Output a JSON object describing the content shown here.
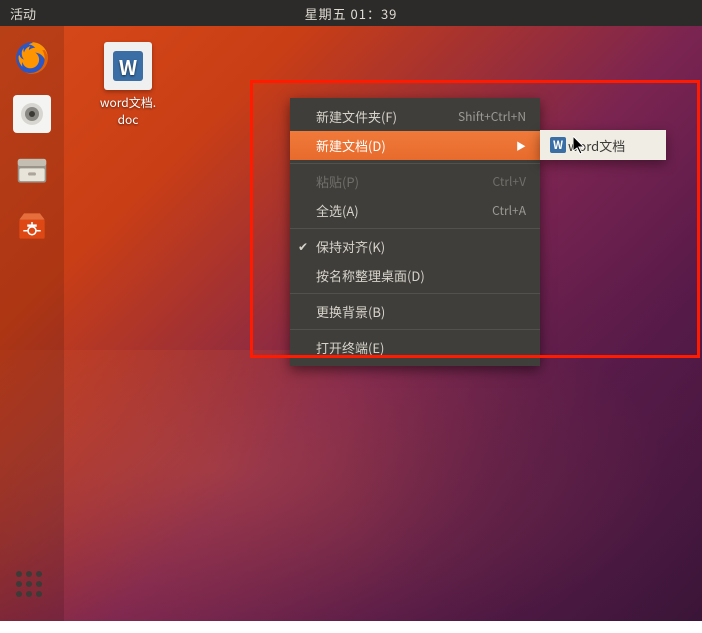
{
  "topbar": {
    "activities": "活动",
    "clock": "星期五 01：39"
  },
  "desktop_icon": {
    "letter": "W",
    "label": "word文档.\ndoc"
  },
  "context_menu": {
    "items": [
      {
        "label": "新建文件夹(F)",
        "shortcut": "Shift+Ctrl+N",
        "active": false
      },
      {
        "label": "新建文档(D)",
        "shortcut": "",
        "active": true,
        "hasSubmenu": true
      },
      {
        "label": "粘贴(P)",
        "shortcut": "Ctrl+V",
        "disabled": true
      },
      {
        "label": "全选(A)",
        "shortcut": "Ctrl+A"
      },
      {
        "label": "保持对齐(K)",
        "checked": true
      },
      {
        "label": "按名称整理桌面(D)"
      },
      {
        "label": "更换背景(B)"
      },
      {
        "label": "打开终端(E)"
      }
    ]
  },
  "submenu": {
    "item_icon_letter": "W",
    "item_label": "word文档"
  }
}
